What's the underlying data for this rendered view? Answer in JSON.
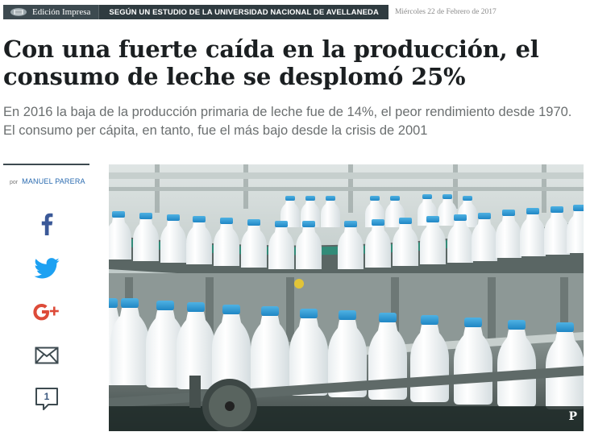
{
  "topbar": {
    "edition_label": "Edición Impresa",
    "source_label": "SEGÚN UN ESTUDIO DE LA UNIVERSIDAD NACIONAL DE AVELLANEDA",
    "date": "Miércoles 22 de Febrero de 2017"
  },
  "article": {
    "headline": "Con una fuerte caída en la producción, el consumo de leche se desplomó 25%",
    "subhead": "En 2016 la baja de la producción primaria de leche fue de 14%, el peor rendimiento desde 1970. El consumo per cápita, en tanto, fue el más bajo desde la crisis de 2001",
    "byline_prefix": "por",
    "author": "MANUEL PARERA"
  },
  "share": {
    "icons": [
      "facebook-icon",
      "twitter-icon",
      "google-plus-icon",
      "email-icon",
      "comment-icon"
    ],
    "comment_count": "1"
  },
  "photo": {
    "overlay_icon": "pinterest-icon",
    "pin_glyph": "P"
  },
  "colors": {
    "bar_dark": "#3d4a50",
    "facebook": "#3b5998",
    "twitter": "#1da1f2",
    "google": "#dd4b39",
    "link": "#2a6bb0"
  }
}
